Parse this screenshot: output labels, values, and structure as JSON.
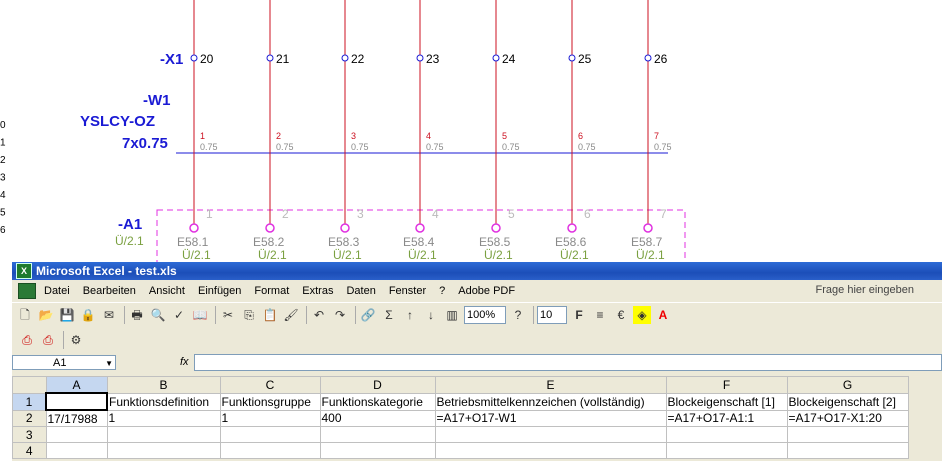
{
  "schematic": {
    "connector_label": "-X1",
    "terminals": [
      "20",
      "21",
      "22",
      "23",
      "24",
      "25",
      "26"
    ],
    "cable_name": "-W1",
    "cable_type": "YSLCY-OZ",
    "cable_spec": "7x0.75",
    "wire_numbers": [
      "1",
      "2",
      "3",
      "4",
      "5",
      "6",
      "7"
    ],
    "wire_cross_section": "0.75",
    "device_label": "-A1",
    "device_ref": "Ü/2.1",
    "device_pins": [
      "1",
      "2",
      "3",
      "4",
      "5",
      "6",
      "7"
    ],
    "device_inputs": [
      "E58.1",
      "E58.2",
      "E58.3",
      "E58.4",
      "E58.5",
      "E58.6",
      "E58.7"
    ],
    "device_pin_refs": [
      "Ü/2.1",
      "Ü/2.1",
      "Ü/2.1",
      "Ü/2.1",
      "Ü/2.1",
      "Ü/2.1",
      "Ü/2.1"
    ],
    "left_margin_numbers": [
      "0",
      "1",
      "2",
      "3",
      "4",
      "5",
      "6"
    ],
    "colors": {
      "blue": "#1a1ad4",
      "red": "#cc1020",
      "grey": "#8a8a8a",
      "green": "#7aa040",
      "magenta": "#e030e0"
    }
  },
  "excel": {
    "title": "Microsoft Excel - test.xls",
    "menu": [
      "Datei",
      "Bearbeiten",
      "Ansicht",
      "Einfügen",
      "Format",
      "Extras",
      "Daten",
      "Fenster",
      "?",
      "Adobe PDF"
    ],
    "help_placeholder": "Frage hier eingeben",
    "zoom": "100%",
    "font_size": "10",
    "name_box": "A1",
    "fx_label": "fx",
    "columns": [
      "A",
      "B",
      "C",
      "D",
      "E",
      "F",
      "G"
    ],
    "rows": [
      {
        "num": "1",
        "cells": [
          "",
          "Funktionsdefinition",
          "Funktionsgruppe",
          "Funktionskategorie",
          "Betriebsmittelkennzeichen (vollständig)",
          "Blockeigenschaft [1]",
          "Blockeigenschaft [2]"
        ]
      },
      {
        "num": "2",
        "cells": [
          "17/17988",
          "1",
          "1",
          "400",
          "=A17+O17-W1",
          "=A17+O17-A1:1",
          "=A17+O17-X1:20"
        ]
      },
      {
        "num": "3",
        "cells": [
          "",
          "",
          "",
          "",
          "",
          "",
          ""
        ]
      },
      {
        "num": "4",
        "cells": [
          "",
          "",
          "",
          "",
          "",
          "",
          ""
        ]
      }
    ]
  }
}
